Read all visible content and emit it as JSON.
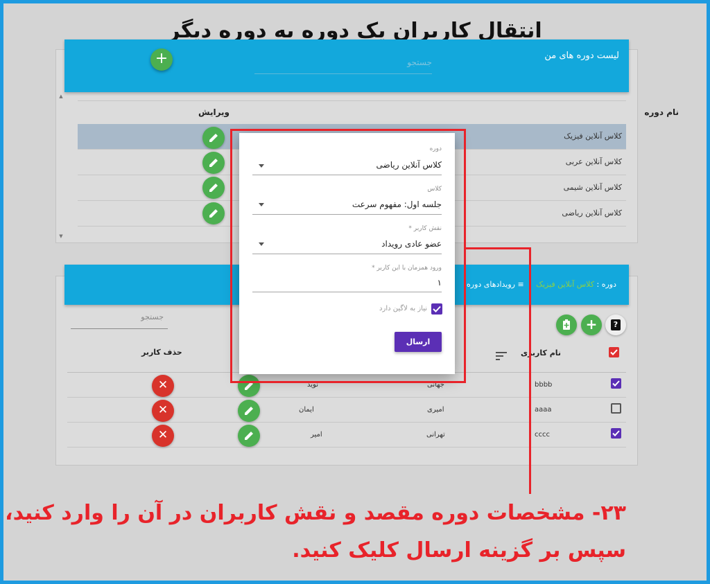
{
  "tutorial": {
    "title": "انتقال کاربران یک دوره به دوره دیگر",
    "instruction_line1": "۲۳- مشخصات دوره مقصد و نقش کاربران در آن را وارد کنید،",
    "instruction_line2": "سپس بر گزینه ارسال کلیک کنید."
  },
  "courses_panel": {
    "title": "لیست دوره های من",
    "search_placeholder": "جستجو",
    "add_icon": "+",
    "columns": {
      "name": "نام دوره",
      "edit": "ویرایش"
    },
    "rows": [
      {
        "name": "کلاس آنلاین فیزیک",
        "selected": true
      },
      {
        "name": "کلاس آنلاین عربی",
        "selected": false
      },
      {
        "name": "کلاس آنلاین شیمی",
        "selected": false
      },
      {
        "name": "کلاس آنلاین ریاضی",
        "selected": false
      }
    ]
  },
  "users_panel": {
    "course_prefix": "دوره :",
    "course_name": "کلاس آنلاین فیزیک",
    "events_tab": "رویدادهای دوره",
    "search_placeholder": "جستجو",
    "columns": {
      "username": "نام کاربری",
      "delete": "حذف کاربر"
    },
    "help_icon": "?",
    "add_icon": "+",
    "rows": [
      {
        "username": "bbbb",
        "last_name": "جهانی",
        "first_name": "نوید",
        "checked": true
      },
      {
        "username": "aaaa",
        "last_name": "امیری",
        "first_name": "ایمان",
        "checked": false
      },
      {
        "username": "cccc",
        "last_name": "تهرانی",
        "first_name": "امیر",
        "checked": true
      }
    ]
  },
  "dialog": {
    "course": {
      "label": "دوره",
      "value": "کلاس آنلاین ریاضی"
    },
    "class": {
      "label": "کلاس",
      "value": "جلسه اول: مفهوم سرعت"
    },
    "role": {
      "label": "نقش کاربر *",
      "value": "عضو عادی رویداد"
    },
    "concurrent": {
      "label": "ورود همزمان با این کاربر *",
      "value": "۱"
    },
    "login_required": {
      "label": "نیاز به لاگین دارد",
      "checked": true
    },
    "submit_label": "ارسال"
  },
  "colors": {
    "header": "#13a8dc",
    "fab_green": "#4caf50",
    "delete_red": "#d8332b",
    "accent_purple": "#5b2fb5",
    "annotation_red": "#e8232a",
    "frame_blue": "#1e9be0"
  }
}
